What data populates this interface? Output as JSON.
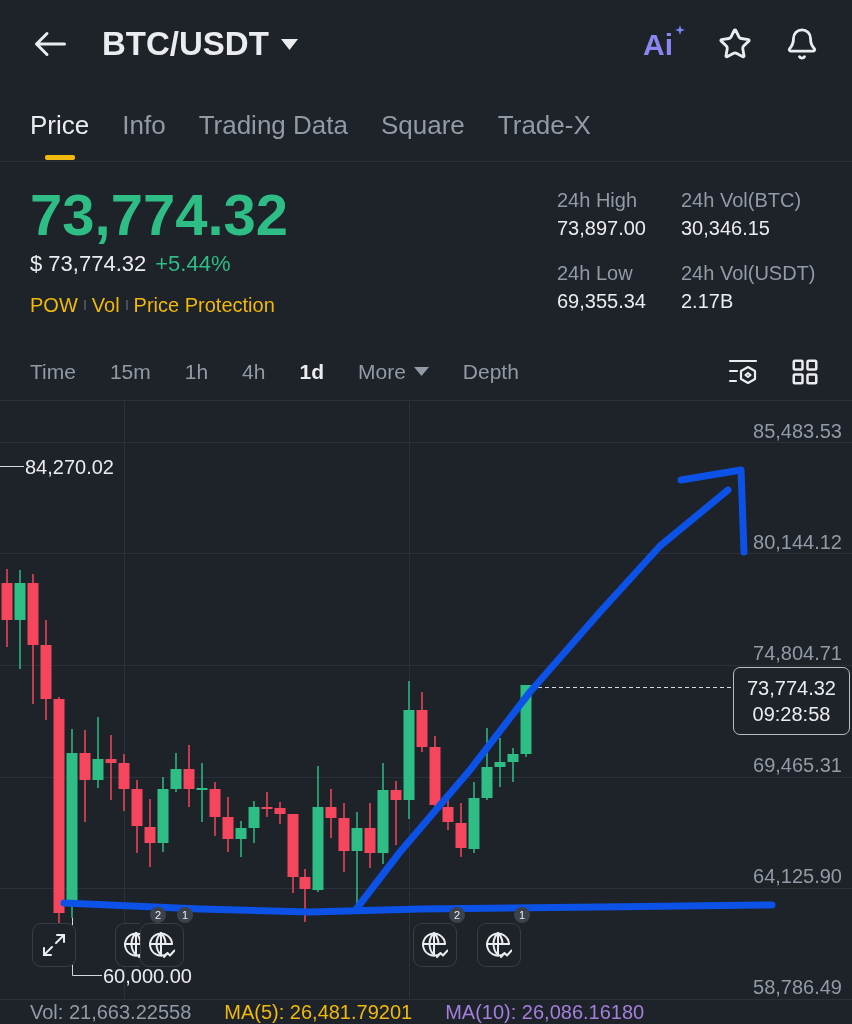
{
  "header": {
    "title": "BTC/USDT",
    "ai_label": "Ai"
  },
  "tabs": [
    {
      "label": "Price",
      "selected": true
    },
    {
      "label": "Info",
      "selected": false
    },
    {
      "label": "Trading Data",
      "selected": false
    },
    {
      "label": "Square",
      "selected": false
    },
    {
      "label": "Trade-X",
      "selected": false
    }
  ],
  "ticker": {
    "last_price": "73,774.32",
    "fiat_price": "$ 73,774.32",
    "change": "+5.44%",
    "rising": true,
    "tags": [
      "POW",
      "Vol",
      "Price Protection"
    ]
  },
  "stats": [
    {
      "label": "24h High",
      "value": "73,897.00"
    },
    {
      "label": "24h Vol(BTC)",
      "value": "30,346.15"
    },
    {
      "label": "24h Low",
      "value": "69,355.34"
    },
    {
      "label": "24h Vol(USDT)",
      "value": "2.17B"
    }
  ],
  "intervals": [
    {
      "label": "Time",
      "kind": "option",
      "selected": false
    },
    {
      "label": "15m",
      "kind": "option",
      "selected": false
    },
    {
      "label": "1h",
      "kind": "option",
      "selected": false
    },
    {
      "label": "4h",
      "kind": "option",
      "selected": false
    },
    {
      "label": "1d",
      "kind": "option",
      "selected": true
    },
    {
      "label": "More",
      "kind": "dropdown",
      "selected": false
    },
    {
      "label": "Depth",
      "kind": "option",
      "selected": false
    }
  ],
  "chart": {
    "price_axis": [
      "85,483.53",
      "80,144.12",
      "74,804.71",
      "69,465.31",
      "64,125.90",
      "58,786.49"
    ],
    "high_marker": "84,270.02",
    "low_marker": "60,000.00",
    "last_price": {
      "price": "73,774.32",
      "countdown": "09:28:58"
    },
    "event_markers": [
      {
        "badge": "2"
      },
      {
        "badge": "1"
      },
      {
        "badge": "2"
      },
      {
        "badge": "1"
      }
    ]
  },
  "indicators": [
    {
      "text": "Vol: 21,663.22558",
      "color": "#929aa5"
    },
    {
      "text": "MA(5): 26,481.79201",
      "color": "#f0b90b"
    },
    {
      "text": "MA(10): 26,086.16180",
      "color": "#a47fdc"
    }
  ]
}
